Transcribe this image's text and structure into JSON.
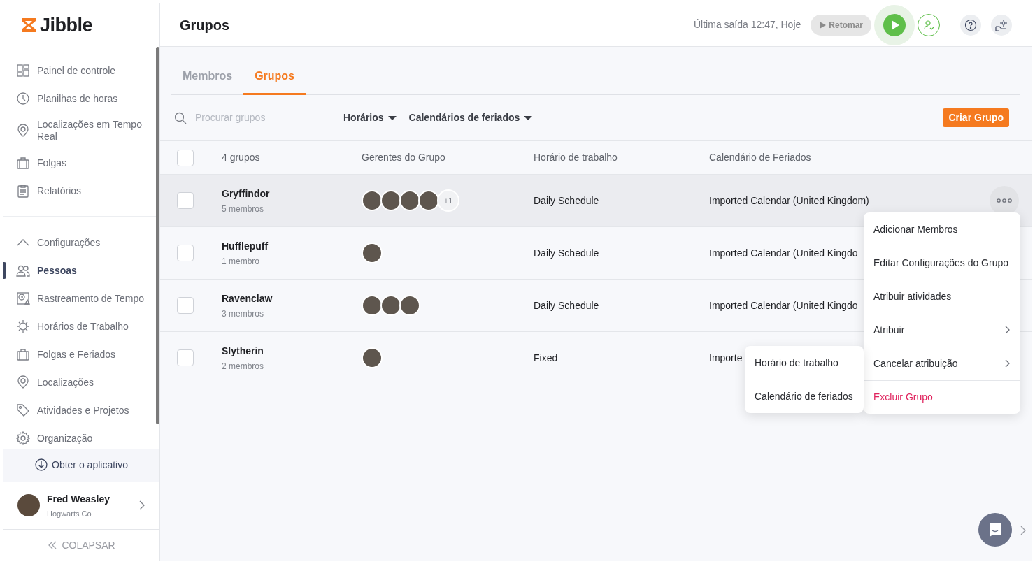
{
  "sidebar": {
    "logo": "Jibble",
    "main_items": [
      {
        "label": "Painel de controle",
        "selected": false
      },
      {
        "label": "Planilhas de horas",
        "selected": false
      },
      {
        "label": "Localizações em Tempo Real",
        "selected": false
      },
      {
        "label": "Folgas",
        "selected": false
      },
      {
        "label": "Relatórios",
        "selected": false
      }
    ],
    "settings": {
      "label": "Configurações",
      "expanded": true,
      "items": [
        {
          "label": "Pessoas",
          "selected": true
        },
        {
          "label": "Rastreamento de Tempo",
          "selected": false
        },
        {
          "label": "Horários de Trabalho",
          "selected": false
        },
        {
          "label": "Folgas e Feriados",
          "selected": false
        },
        {
          "label": "Localizações",
          "selected": false
        },
        {
          "label": "Atividades e Projetos",
          "selected": false
        },
        {
          "label": "Organização",
          "selected": false
        }
      ]
    },
    "get_app": "Obter o aplicativo",
    "user": {
      "name": "Fred Weasley",
      "company": "Hogwarts Co"
    },
    "collapse": "COLAPSAR"
  },
  "header": {
    "title": "Grupos",
    "last_out": "Última saída 12:47, Hoje",
    "resume_button": "Retomar"
  },
  "tabs": [
    {
      "label": "Membros",
      "selected": false
    },
    {
      "label": "Grupos",
      "selected": true
    }
  ],
  "toolbar": {
    "search": {
      "placeholder": "Procurar grupos"
    },
    "filters": [
      "Horários",
      "Calendários de feriados"
    ],
    "create_button": "Criar Grupo"
  },
  "table": {
    "select_all": {
      "checked": false
    },
    "columns": [
      "4 grupos",
      "Gerentes do Grupo",
      "Horário de trabalho",
      "Calendário de Feriados"
    ],
    "rows": [
      {
        "name": "Gryffindor",
        "members": "5 membros",
        "checked": false,
        "highlighted": true,
        "managers": [
          {
            "kind": "photo"
          },
          {
            "kind": "photo"
          },
          {
            "kind": "photo"
          },
          {
            "kind": "photo"
          }
        ],
        "more": "+1",
        "schedule": "Daily Schedule",
        "calendar": "Imported Calendar (United Kingdom)"
      },
      {
        "name": "Hufflepuff",
        "members": "1 membro",
        "checked": false,
        "highlighted": false,
        "managers": [
          {
            "kind": "photo"
          }
        ],
        "schedule": "Daily Schedule",
        "calendar": "Imported Calendar (United Kingdo"
      },
      {
        "name": "Ravenclaw",
        "members": "3 membros",
        "checked": false,
        "highlighted": false,
        "managers": [
          {
            "kind": "photo"
          },
          {
            "kind": "photo"
          },
          {
            "kind": "photo"
          }
        ],
        "schedule": "Daily Schedule",
        "calendar": "Imported Calendar (United Kingdo"
      },
      {
        "name": "Slytherin",
        "members": "2 membros",
        "checked": false,
        "highlighted": false,
        "managers": [
          {
            "kind": "photo"
          }
        ],
        "schedule": "Fixed",
        "calendar": "Importe"
      }
    ]
  },
  "context_menu": {
    "items": [
      {
        "label": "Adicionar Membros",
        "kind": "item"
      },
      {
        "label": "Editar Configurações do Grupo",
        "kind": "item"
      },
      {
        "label": "Atribuir atividades",
        "kind": "item"
      },
      {
        "label": "Atribuir",
        "kind": "submenu",
        "expanded": false
      },
      {
        "label": "Cancelar atribuição",
        "kind": "submenu",
        "expanded": true
      },
      {
        "label": "Excluir Grupo",
        "kind": "danger"
      }
    ],
    "submenu": [
      "Horário de trabalho",
      "Calendário de feriados"
    ]
  }
}
